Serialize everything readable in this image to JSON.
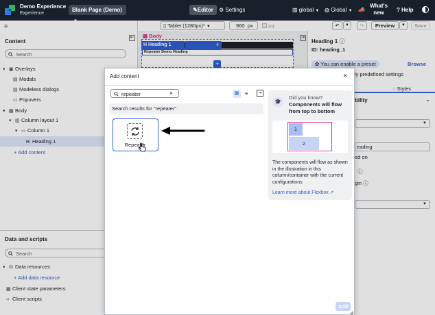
{
  "header": {
    "app_name": "Demo Experience",
    "app_sub": "Experience",
    "page_selector": "Blank Page (Demo)",
    "editor_tab": "Editor",
    "settings_tab": "Settings",
    "scope_global_lower": "global",
    "scope_global": "Global",
    "whats_new": "What's new",
    "help": "Help",
    "colors": {
      "bar": "#17202b",
      "active": "#4b5560"
    }
  },
  "left_panel": {
    "content_title": "Content",
    "search_placeholder": "Search",
    "tree": {
      "overlays": "Overlays",
      "modals": "Modals",
      "modeless": "Modeless dialogs",
      "popovers": "Popovers",
      "body": "Body",
      "column_layout": "Column layout 1",
      "column": "Column 1",
      "heading": "Heading 1",
      "add_content": "Add content"
    },
    "data_title": "Data and scripts",
    "data_search_placeholder": "Search",
    "data_resources": "Data resources",
    "add_data_resource": "Add data resource",
    "client_state": "Client state parameters",
    "client_scripts": "Client scripts"
  },
  "toolbar": {
    "device": "Tablet (1280px)*",
    "width_value": "960",
    "width_unit": "px",
    "fit": "Fit",
    "preview": "Preview",
    "save": "Save"
  },
  "canvas": {
    "body_tag": "Body",
    "heading_chip": "Heading 1",
    "demo_heading": "Repeater Demo Heading"
  },
  "right_panel": {
    "title": "Heading 1",
    "id_label": "ID: heading_1",
    "preset_text": "You can enable a preset",
    "browse": "Browse",
    "preset_sub": "ly predefined settings",
    "styles_tab": "Styles",
    "section": "bility",
    "field_partial_1": "eading",
    "field_partial_2": "ed on",
    "field_partial_3": "gin"
  },
  "modal": {
    "title": "Add content",
    "search_value": "repeater",
    "results_label": "Search results for \"repeater\"",
    "card_label": "Repeater",
    "did_you_know": "Did you know?",
    "tip_title": "Components will flow from top to bottom",
    "diagram_1": "1",
    "diagram_2": "2",
    "tip_body": "The components will flow as shown in the illustration in this column/container with the current configurations",
    "learn_more": "Learn more about Flexbox",
    "add_button": "Add"
  }
}
